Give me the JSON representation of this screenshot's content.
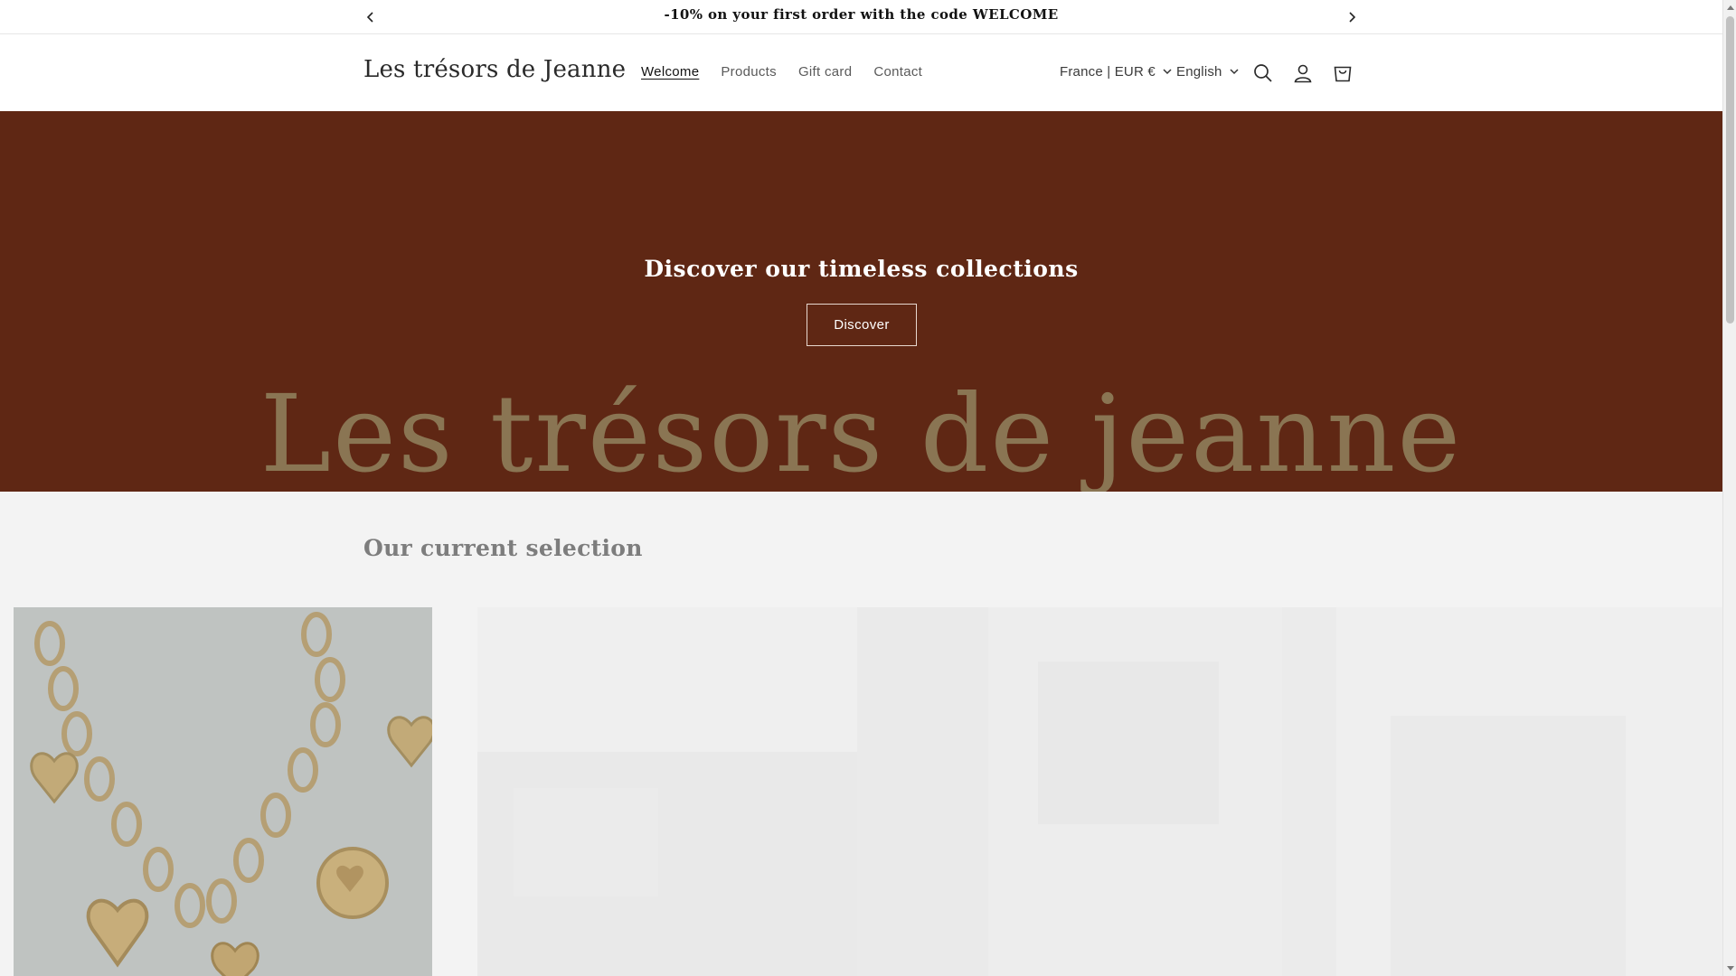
{
  "announcement": {
    "message": "-10% on your first order with the code WELCOME",
    "prev_icon": "chevron-left-icon",
    "next_icon": "chevron-right-icon"
  },
  "header": {
    "logo": "Les trésors de Jeanne",
    "nav": [
      {
        "label": "Welcome",
        "active": true
      },
      {
        "label": "Products",
        "active": false
      },
      {
        "label": "Gift card",
        "active": false
      },
      {
        "label": "Contact",
        "active": false
      }
    ],
    "country_selector": "France | EUR €",
    "language_selector": "English",
    "icons": [
      "search-icon",
      "account-icon",
      "cart-icon"
    ]
  },
  "hero": {
    "title": "Discover our timeless collections",
    "button_label": "Discover",
    "watermark_text": "Les trésors de jeanne",
    "background_color": "#5f2714"
  },
  "selection": {
    "title": "Our current selection"
  },
  "colors": {
    "hero_background": "#5f2714",
    "text": "#121212",
    "watermark": "#8a7553"
  }
}
